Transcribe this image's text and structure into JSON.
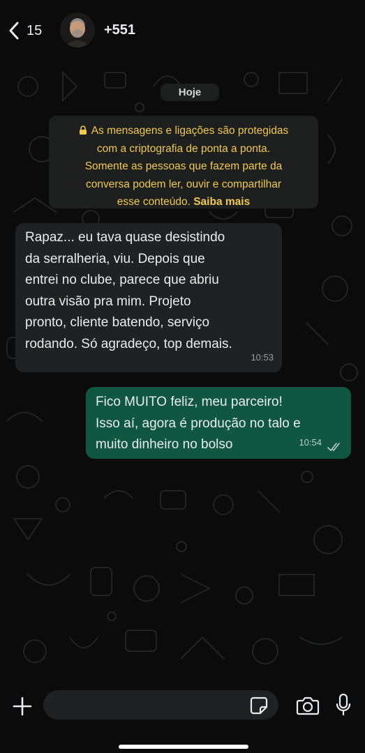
{
  "header": {
    "back_count": "15",
    "contact_name": "+551",
    "icons": {
      "back": "chevron-left-icon",
      "avatar": "contact-avatar"
    }
  },
  "chat": {
    "date_chip": "Hoje",
    "notice": {
      "text": "As mensagens e ligações são protegidas com a criptografia de ponta a ponta. Somente as pessoas que fazem parte da conversa podem ler, ouvir e compartilhar esse conteúdo.",
      "lines": [
        "As mensagens e ligações são protegidas",
        "com a criptografia de ponta a ponta.",
        "Somente as pessoas que fazem parte da",
        "conversa podem ler, ouvir e compartilhar",
        "esse conteúdo."
      ],
      "learn_more": "Saiba mais",
      "icon": "lock-icon",
      "color": "#f1c94b"
    },
    "messages": [
      {
        "direction": "incoming",
        "lines": [
          "Rapaz... eu tava quase desistindo",
          "da serralheria, viu. Depois que",
          "entrei no clube, parece que abriu",
          "outra visão pra mim. Projeto",
          "pronto, cliente batendo, serviço",
          "rodando. Só agradeço, top demais."
        ],
        "time": "10:53",
        "bubble_color": "#1f2122"
      },
      {
        "direction": "outgoing",
        "lines": [
          "Fico MUITO feliz, meu parceiro!",
          "Isso aí, agora é produção no talo e",
          "muito dinheiro no bolso"
        ],
        "time": "10:54",
        "status": "read",
        "status_icon": "double-check-icon",
        "bubble_color": "#0f5741"
      }
    ]
  },
  "composer": {
    "placeholder": "",
    "icons": [
      "plus-icon",
      "sticker-icon",
      "camera-icon",
      "mic-icon"
    ]
  },
  "colors": {
    "background": "#0b0b0b",
    "outgoing_bubble": "#0f5741",
    "incoming_bubble": "#1f2122",
    "notice_text": "#f1c94b"
  }
}
